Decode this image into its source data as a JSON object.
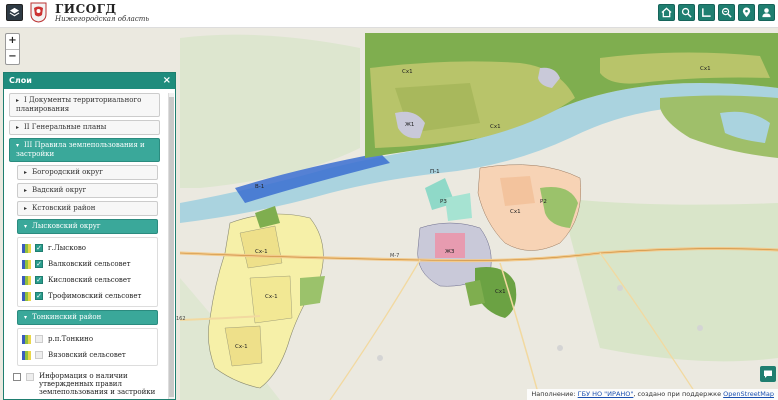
{
  "header": {
    "title": "ГИСОГД",
    "subtitle": "Нижегородская область"
  },
  "toolbar": {
    "buttons": [
      {
        "name": "home-icon"
      },
      {
        "name": "search-icon"
      },
      {
        "name": "measure-icon"
      },
      {
        "name": "search-plot-icon"
      },
      {
        "name": "location-icon"
      },
      {
        "name": "user-icon"
      }
    ]
  },
  "zoom": {
    "in": "+",
    "out": "−"
  },
  "panel": {
    "title": "Слои",
    "close": "×",
    "groups": [
      {
        "label": "I Документы территориального планирования",
        "expanded": false
      },
      {
        "label": "II Генеральные планы",
        "expanded": false
      },
      {
        "label": "III Правила землепользования и застройки",
        "expanded": true
      }
    ],
    "subgroups": [
      {
        "label": "Богородский округ"
      },
      {
        "label": "Вадский округ"
      },
      {
        "label": "Кстовский район"
      }
    ],
    "lyskovo": {
      "label": "Лысковский округ",
      "items": [
        {
          "label": "г.Лысково",
          "checked": true
        },
        {
          "label": "Валковский сельсовет",
          "checked": true
        },
        {
          "label": "Кисловский сельсовет",
          "checked": true
        },
        {
          "label": "Трофимовский сельсовет",
          "checked": true
        }
      ]
    },
    "tonkino": {
      "label": "Тонкинский район",
      "items": [
        {
          "label": "р.п.Тонкино",
          "checked": false
        },
        {
          "label": "Вязовский сельсовет",
          "checked": false
        }
      ]
    },
    "info": {
      "label": "Информация о наличии утвержденных правил землепользования и застройки",
      "checked": false
    }
  },
  "map": {
    "road_labels": [
      "М-7",
      "162"
    ],
    "zone_labels": [
      "Сх1",
      "Сх-1",
      "Р3",
      "П-1",
      "В-1",
      "Р2",
      "ЖЗ",
      "Ж1"
    ]
  },
  "attribution": {
    "prefix": "Наполнение: ",
    "org": "ГБУ НО \"ИРАНО\"",
    "middle": ", создано при поддержке ",
    "osm": "OpenStreetMap"
  },
  "colors": {
    "accent": "#1f7e70",
    "water": "#aad3df",
    "agri_green": "#7fae4f",
    "agri_olive": "#b8c46a",
    "residential_yellow": "#f6f0a8",
    "commercial_peach": "#f7d3b5",
    "river_blue": "#3b6fd1"
  }
}
